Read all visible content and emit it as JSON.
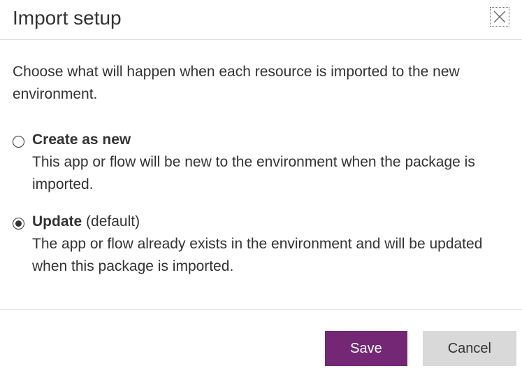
{
  "header": {
    "title": "Import setup"
  },
  "instructions": "Choose what will happen when each resource is imported to the new environment.",
  "options": {
    "create": {
      "label": "Create as new",
      "suffix": "",
      "selected": false,
      "description": "This app or flow will be new to the environment when the package is imported."
    },
    "update": {
      "label": "Update",
      "suffix": " (default)",
      "selected": true,
      "description": "The app or flow already exists in the environment and will be updated when this package is imported."
    }
  },
  "footer": {
    "save_label": "Save",
    "cancel_label": "Cancel"
  }
}
